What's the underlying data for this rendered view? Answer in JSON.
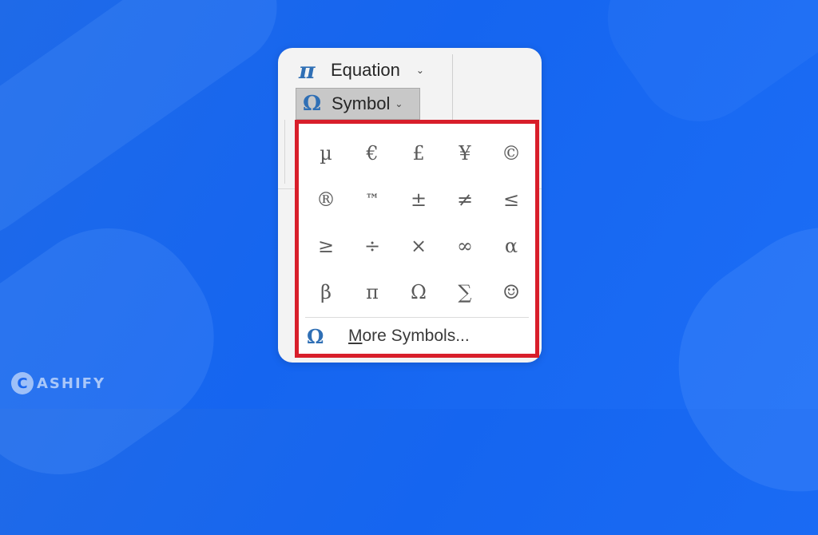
{
  "ribbon": {
    "equation": {
      "icon": "π",
      "label": "Equation",
      "chevron": "⌄"
    },
    "symbol": {
      "icon": "Ω",
      "label": "Symbol",
      "chevron": "⌄"
    }
  },
  "dropdown": {
    "symbols": [
      [
        "µ",
        "€",
        "£",
        "¥",
        "©"
      ],
      [
        "®",
        "™",
        "±",
        "≠",
        "≤"
      ],
      [
        "≥",
        "÷",
        "×",
        "∞",
        "α"
      ],
      [
        "β",
        "π",
        "Ω",
        "∑",
        "☺"
      ]
    ],
    "more_symbols": {
      "icon": "Ω",
      "label_accel": "M",
      "label_rest": "ore Symbols..."
    }
  },
  "brand": {
    "mark": "C",
    "text": "ASHIFY"
  }
}
